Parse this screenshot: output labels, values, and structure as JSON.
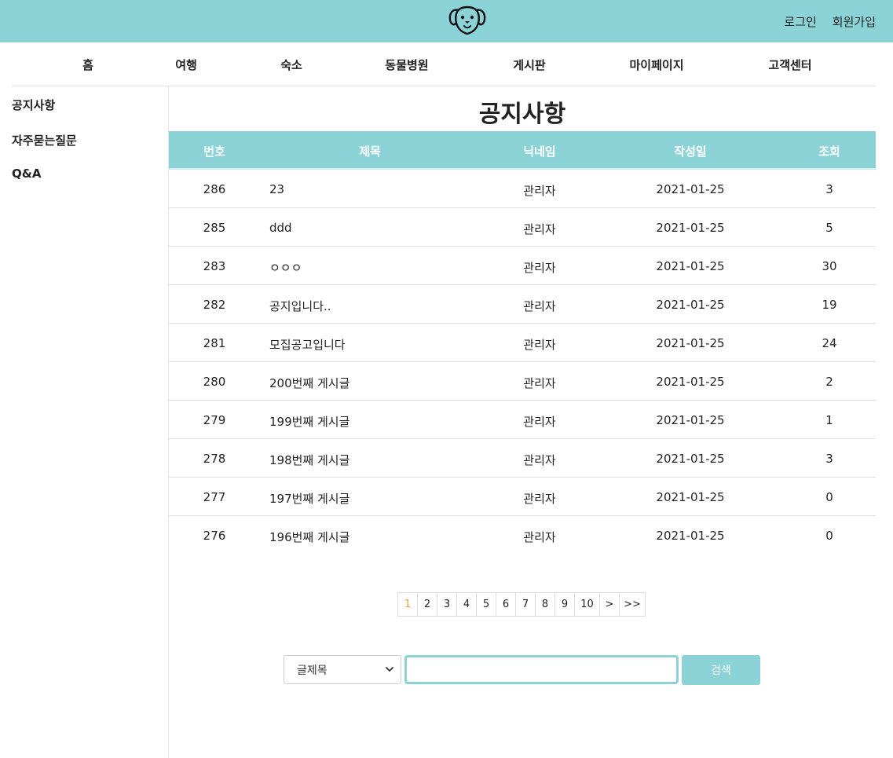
{
  "header": {
    "logo_icon": "dog-face-icon",
    "auth": {
      "login": "로그인",
      "signup": "회원가입"
    },
    "bg_color": "#8bd3d7"
  },
  "nav": {
    "items": [
      {
        "label": "홈"
      },
      {
        "label": "여행"
      },
      {
        "label": "숙소"
      },
      {
        "label": "동물병원"
      },
      {
        "label": "게시판"
      },
      {
        "label": "마이페이지"
      },
      {
        "label": "고객센터"
      }
    ]
  },
  "sidebar": {
    "items": [
      {
        "label": "공지사항"
      },
      {
        "label": "자주묻는질문"
      },
      {
        "label": "Q&A"
      }
    ]
  },
  "main": {
    "title": "공지사항",
    "table": {
      "headers": {
        "num": "번호",
        "title": "제목",
        "nick": "닉네임",
        "date": "작성일",
        "views": "조회"
      },
      "rows": [
        {
          "num": "286",
          "title": "23",
          "nick": "관리자",
          "date": "2021-01-25",
          "views": "3"
        },
        {
          "num": "285",
          "title": "ddd",
          "nick": "관리자",
          "date": "2021-01-25",
          "views": "5"
        },
        {
          "num": "283",
          "title": "ㅇㅇㅇ",
          "nick": "관리자",
          "date": "2021-01-25",
          "views": "30"
        },
        {
          "num": "282",
          "title": "공지입니다..",
          "nick": "관리자",
          "date": "2021-01-25",
          "views": "19"
        },
        {
          "num": "281",
          "title": "모집공고입니다",
          "nick": "관리자",
          "date": "2021-01-25",
          "views": "24"
        },
        {
          "num": "280",
          "title": "200번째 게시글",
          "nick": "관리자",
          "date": "2021-01-25",
          "views": "2"
        },
        {
          "num": "279",
          "title": "199번째 게시글",
          "nick": "관리자",
          "date": "2021-01-25",
          "views": "1"
        },
        {
          "num": "278",
          "title": "198번째 게시글",
          "nick": "관리자",
          "date": "2021-01-25",
          "views": "3"
        },
        {
          "num": "277",
          "title": "197번째 게시글",
          "nick": "관리자",
          "date": "2021-01-25",
          "views": "0"
        },
        {
          "num": "276",
          "title": "196번째 게시글",
          "nick": "관리자",
          "date": "2021-01-25",
          "views": "0"
        }
      ]
    },
    "pagination": {
      "pages": [
        "1",
        "2",
        "3",
        "4",
        "5",
        "6",
        "7",
        "8",
        "9",
        "10"
      ],
      "current": "1",
      "next": ">",
      "last": ">>",
      "active_color": "#f0a040"
    },
    "search": {
      "select_value": "글제목",
      "input_value": "",
      "button_label": "검색",
      "chevron_icon": "chevron-down-icon"
    }
  }
}
